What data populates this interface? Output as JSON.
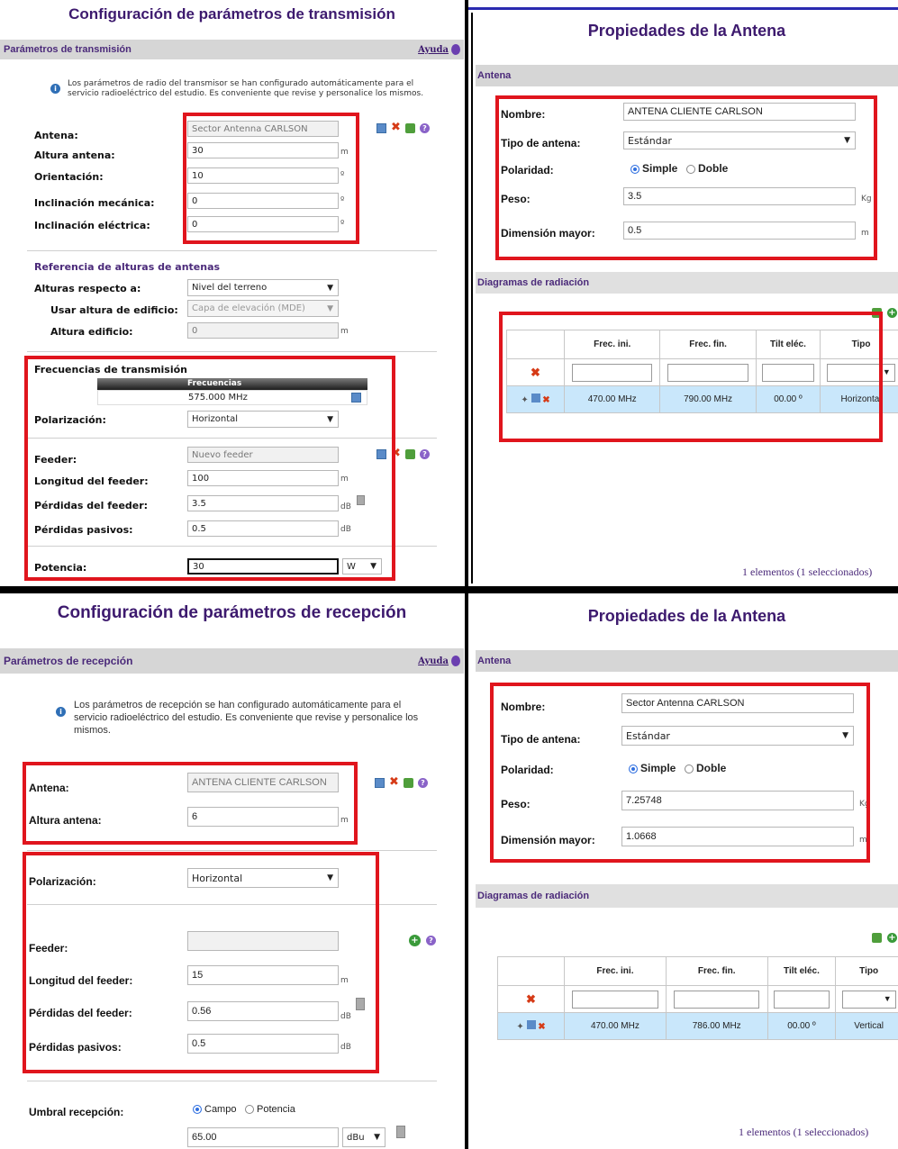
{
  "tx": {
    "title": "Configuración de parámetros de transmisión",
    "section": "Parámetros de transmisión",
    "help": "Ayuda",
    "note": "Los parámetros de radio del transmisor se han configurado automáticamente para el servicio radioeléctrico del estudio. Es conveniente que revise y personalice los mismos.",
    "antena_label": "Antena:",
    "antena_value": "Sector Antenna CARLSON",
    "altura_label": "Altura antena:",
    "altura_value": "30",
    "altura_unit": "m",
    "orient_label": "Orientación:",
    "orient_value": "10",
    "orient_unit": "º",
    "incmec_label": "Inclinación mecánica:",
    "incmec_value": "0",
    "incmec_unit": "º",
    "incele_label": "Inclinación eléctrica:",
    "incele_value": "0",
    "incele_unit": "º",
    "ref_title": "Referencia de alturas de antenas",
    "alturas_label": "Alturas respecto a:",
    "alturas_value": "Nivel del terreno",
    "usar_label": "Usar altura de edificio:",
    "usar_value": "Capa de elevación (MDE)",
    "edif_label": "Altura edificio:",
    "edif_value": "0",
    "edif_unit": "m",
    "frec_title": "Frecuencias de transmisión",
    "frec_header": "Frecuencias",
    "frec_value": "575.000 MHz",
    "pol_label": "Polarización:",
    "pol_value": "Horizontal",
    "feeder_label": "Feeder:",
    "feeder_value": "Nuevo feeder",
    "long_label": "Longitud del feeder:",
    "long_value": "100",
    "long_unit": "m",
    "perd_label": "Pérdidas del feeder:",
    "perd_value": "3.5",
    "perd_unit": "dB",
    "pas_label": "Pérdidas pasivos:",
    "pas_value": "0.5",
    "pas_unit": "dB",
    "pot_label": "Potencia:",
    "pot_value": "30",
    "pot_unit": "W"
  },
  "ant1": {
    "title": "Propiedades de la Antena",
    "section": "Antena",
    "nombre_label": "Nombre:",
    "nombre_value": "ANTENA CLIENTE CARLSON",
    "tipo_label": "Tipo de antena:",
    "tipo_value": "Estándar",
    "pol_label": "Polaridad:",
    "pol_simple": "Simple",
    "pol_doble": "Doble",
    "peso_label": "Peso:",
    "peso_value": "3.5",
    "peso_unit": "Kg",
    "dim_label": "Dimensión mayor:",
    "dim_value": "0.5",
    "dim_unit": "m",
    "diag_section": "Diagramas de radiación",
    "cols": [
      "Frec. ini.",
      "Frec. fin.",
      "Tilt eléc.",
      "Tipo"
    ],
    "row": [
      "470.00 MHz",
      "790.00 MHz",
      "00.00 º",
      "Horizontal"
    ],
    "footer": "1 elementos (1 seleccionados)"
  },
  "rx": {
    "title": "Configuración de parámetros de recepción",
    "section": "Parámetros de recepción",
    "help": "Ayuda",
    "note": "Los parámetros de recepción se han configurado automáticamente para el servicio radioeléctrico del estudio. Es conveniente que revise y personalice los mismos.",
    "antena_label": "Antena:",
    "antena_value": "ANTENA CLIENTE CARLSON",
    "altura_label": "Altura antena:",
    "altura_value": "6",
    "altura_unit": "m",
    "pol_label": "Polarización:",
    "pol_value": "Horizontal",
    "feeder_label": "Feeder:",
    "feeder_value": "",
    "long_label": "Longitud del feeder:",
    "long_value": "15",
    "long_unit": "m",
    "perd_label": "Pérdidas del feeder:",
    "perd_value": "0.56",
    "perd_unit": "dB",
    "pas_label": "Pérdidas pasivos:",
    "pas_value": "0.5",
    "pas_unit": "dB",
    "umbral_label": "Umbral recepción:",
    "umbral_campo": "Campo",
    "umbral_pot": "Potencia",
    "umbral_value": "65.00",
    "umbral_unit": "dBu"
  },
  "ant2": {
    "title": "Propiedades de la Antena",
    "section": "Antena",
    "nombre_label": "Nombre:",
    "nombre_value": "Sector Antenna CARLSON",
    "tipo_label": "Tipo de antena:",
    "tipo_value": "Estándar",
    "pol_label": "Polaridad:",
    "pol_simple": "Simple",
    "pol_doble": "Doble",
    "peso_label": "Peso:",
    "peso_value": "7.25748",
    "peso_unit": "Kg",
    "dim_label": "Dimensión mayor:",
    "dim_value": "1.0668",
    "dim_unit": "m",
    "diag_section": "Diagramas de radiación",
    "cols": [
      "Frec. ini.",
      "Frec. fin.",
      "Tilt eléc.",
      "Tipo"
    ],
    "row": [
      "470.00 MHz",
      "786.00 MHz",
      "00.00 º",
      "Vertical"
    ],
    "footer": "1 elementos (1 seleccionados)"
  }
}
